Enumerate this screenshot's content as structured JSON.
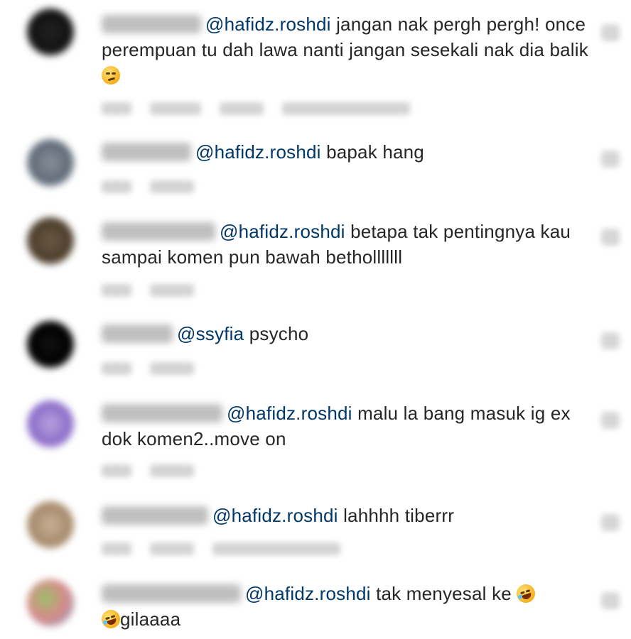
{
  "comments": [
    {
      "mention": "@hafidz.roshdi",
      "text": "jangan nak pergh pergh! once perempuan tu dah lawa nanti jangan sesekali nak dia balik",
      "emoji": "smirking-face-icon"
    },
    {
      "mention": "@hafidz.roshdi",
      "text": "bapak hang"
    },
    {
      "mention": "@hafidz.roshdi",
      "text": "betapa tak pentingnya kau sampai komen pun bawah betholllllll"
    },
    {
      "mention": "@ssyfia",
      "text": "psycho"
    },
    {
      "mention": "@hafidz.roshdi",
      "text": "malu la bang masuk ig ex dok komen2..move on"
    },
    {
      "mention": "@hafidz.roshdi",
      "text": "lahhhh tiberrr"
    },
    {
      "mention": "@hafidz.roshdi",
      "text": "tak menyesal ke",
      "text_after_emoji": "gilaaaa",
      "emoji": "rolling-laughing-face-icon"
    }
  ],
  "colors": {
    "mention": "#00376b",
    "text": "#262626",
    "blur_placeholder": "#bfbfbf"
  }
}
